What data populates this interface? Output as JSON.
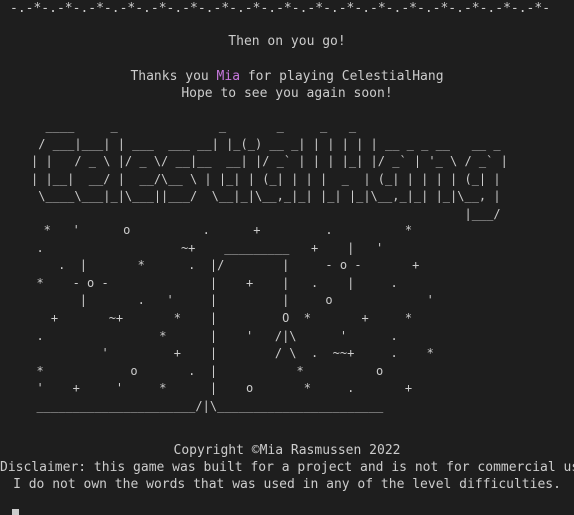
{
  "terminal": {
    "top_border": "-.-*-.-*-.-*-.-*-.-*-.-*-.-*-.-*-.-*-.-*-.-*-.-*-.-*-.-*-.-*-.-*-.-*-",
    "then_text": "Then on you go!",
    "thanks_prefix": "Thanks you ",
    "player_name": "Mia",
    "thanks_suffix": " for playing CelestialHang",
    "goodbye_text": "Hope to see you again soon!",
    "logo_art": "  ____     _              _       _     _   _\n / ___|___| | ___  ___ __| |_(_) __ _| | | | | | __ _ _ __   __ _\n| |   / _ \\ |/ _ \\/ __|__  __| |/ _` | | | |_| |/ _` | '_ \\ / _` |\n| |__|  __/ |  __/\\__ \\ | |_| | (_| | | |  _  | (_| | | | | (_| |\n \\____\\___|_|\\___||___/  \\__|_|\\__,_|_| |_| |_|\\__,_|_| |_|\\__, |\n                                                            |___/",
    "hangman_art": "   *   '      o          .      +         .          *\n  .                   ~+    _________   +    |   '\n     .  |       *      .  |/        |     - o -       +\n  *    - o -              |    +    |   .    |     .\n        |       .   '     |         |     o             '\n    +       ~+       *    |         O  *       +     *\n  .                *      |    '   /|\\      '      .\n           '         +    |        / \\  .  ~~+     .    *\n  *            o       .  |           *          o\n  '    +     '     *      |    o       *     .       +\n  ______________________/|\\_______________________",
    "copyright_text": "Copyright ©Mia Rasmussen 2022",
    "disclaimer_text": "Disclaimer: this game was built for a project and is not for commercial use",
    "words_text": "I do not own the words that was used in any of the level difficulties."
  }
}
